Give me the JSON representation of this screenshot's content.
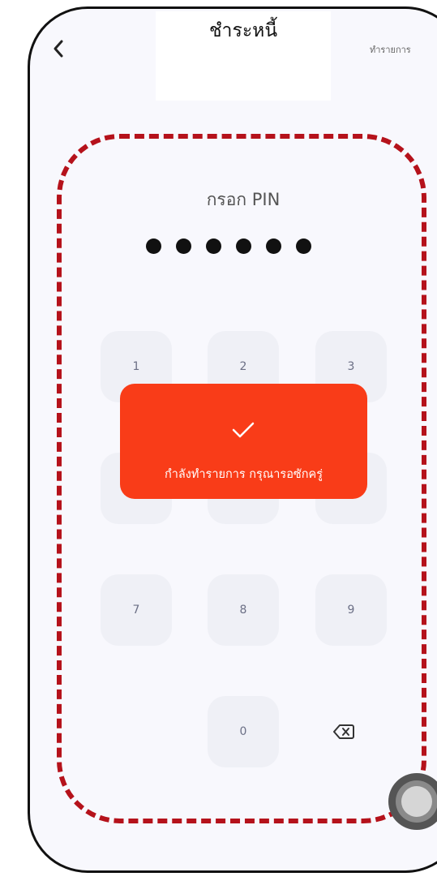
{
  "header": {
    "title": "ชำระหนี้",
    "history_link": "ทำรายการ",
    "back_icon": "chevron-left-icon"
  },
  "pin": {
    "title": "กรอก PIN",
    "entered_digits": 6
  },
  "keypad": {
    "keys": [
      "1",
      "2",
      "3",
      "7",
      "8",
      "9",
      "0"
    ],
    "delete_icon": "backspace-icon"
  },
  "toast": {
    "icon": "check-icon",
    "message": "กำลังทำรายการ กรุณารอซักครู่"
  },
  "colors": {
    "toast": "#f93c18",
    "highlight": "#b5121b",
    "background": "#f8f8fd"
  }
}
